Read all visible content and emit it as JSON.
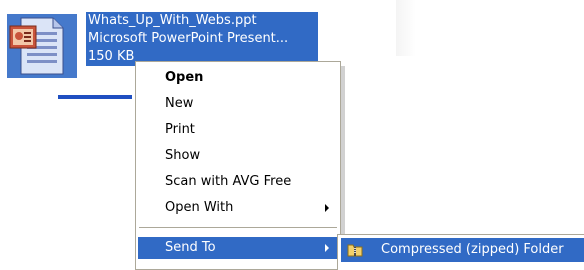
{
  "file": {
    "name": "Whats_Up_With_Webs.ppt",
    "type": "Microsoft PowerPoint Present...",
    "size": "150 KB",
    "icon": "powerpoint-file-icon"
  },
  "context_menu": {
    "items": [
      {
        "label": "Open",
        "bold": true
      },
      {
        "label": "New"
      },
      {
        "label": "Print"
      },
      {
        "label": "Show"
      },
      {
        "label": "Scan with AVG Free"
      },
      {
        "label": "Open With",
        "has_submenu": true
      },
      {
        "label": "Send To",
        "has_submenu": true,
        "highlighted": true
      }
    ]
  },
  "submenu": {
    "items": [
      {
        "label": "Compressed (zipped) Folder",
        "icon": "zip-folder-icon",
        "highlighted": true
      }
    ]
  },
  "colors": {
    "selection": "#316ac5",
    "menu_border": "#aca899",
    "menu_background": "#ffffff"
  }
}
